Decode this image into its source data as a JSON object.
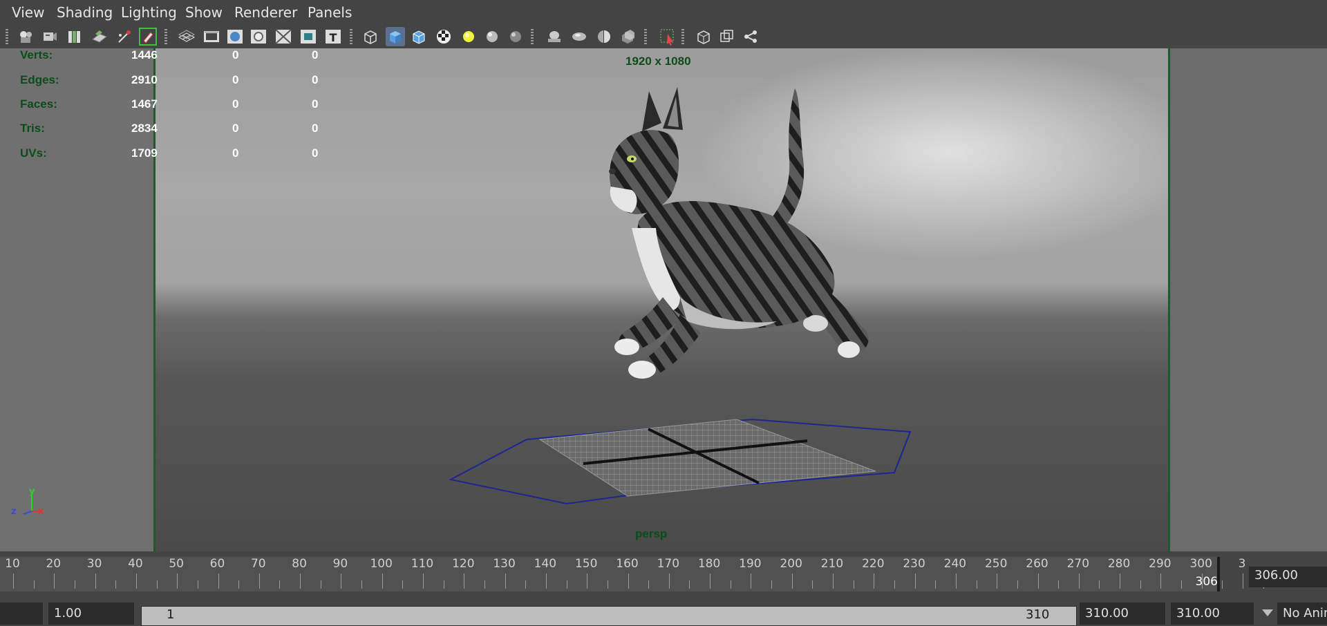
{
  "menu": {
    "items": [
      "View",
      "Shading",
      "Lighting",
      "Show",
      "Renderer",
      "Panels"
    ]
  },
  "toolbar": {
    "icons": [
      "select-camera-icon",
      "camera-attributes-icon",
      "bookmarks-icon",
      "image-plane-icon",
      "2d-pan-zoom-icon",
      "grease-pencil-icon",
      "grid-icon",
      "film-gate-icon",
      "resolution-gate-icon",
      "gate-mask-icon",
      "field-chart-icon",
      "safe-title-icon",
      "wireframe-icon",
      "smooth-shade-icon",
      "wireframe-on-shaded-icon",
      "textured-icon",
      "use-all-lights-icon",
      "shadows-icon",
      "screen-space-ao-icon",
      "motion-blur-icon",
      "multisample-aa-icon",
      "depth-of-field-icon",
      "xray-icon",
      "isolate-select-icon",
      "xray-joints-icon",
      "xray-components-icon",
      "camera-sequencer-icon"
    ],
    "active_icon": "smooth-shade-icon",
    "accent_color": "#5b6f8e"
  },
  "viewport": {
    "resolution_label": "1920 x 1080",
    "camera_label": "persp",
    "hud_color": "#0b4d1a",
    "stats": [
      {
        "label": "Verts:",
        "values": [
          "1446",
          "0",
          "0"
        ]
      },
      {
        "label": "Edges:",
        "values": [
          "2910",
          "0",
          "0"
        ]
      },
      {
        "label": "Faces:",
        "values": [
          "1467",
          "0",
          "0"
        ]
      },
      {
        "label": "Tris:",
        "values": [
          "2834",
          "0",
          "0"
        ]
      },
      {
        "label": "UVs:",
        "values": [
          "1709",
          "0",
          "0"
        ]
      }
    ],
    "axis": {
      "y": "y",
      "z": "z",
      "x": "x"
    }
  },
  "timeline": {
    "tick_labels": [
      "10",
      "20",
      "30",
      "40",
      "50",
      "60",
      "70",
      "80",
      "90",
      "100",
      "110",
      "120",
      "130",
      "140",
      "150",
      "160",
      "170",
      "180",
      "190",
      "200",
      "210",
      "220",
      "230",
      "240",
      "250",
      "260",
      "270",
      "280",
      "290",
      "300",
      "3"
    ],
    "current_frame": "306",
    "current_time": "306.00"
  },
  "range": {
    "start_field": "1.00",
    "slider_start": "1",
    "slider_end": "310",
    "end_field": "310.00",
    "anim_end_field": "310.00",
    "anim_layer": "No Anim"
  }
}
